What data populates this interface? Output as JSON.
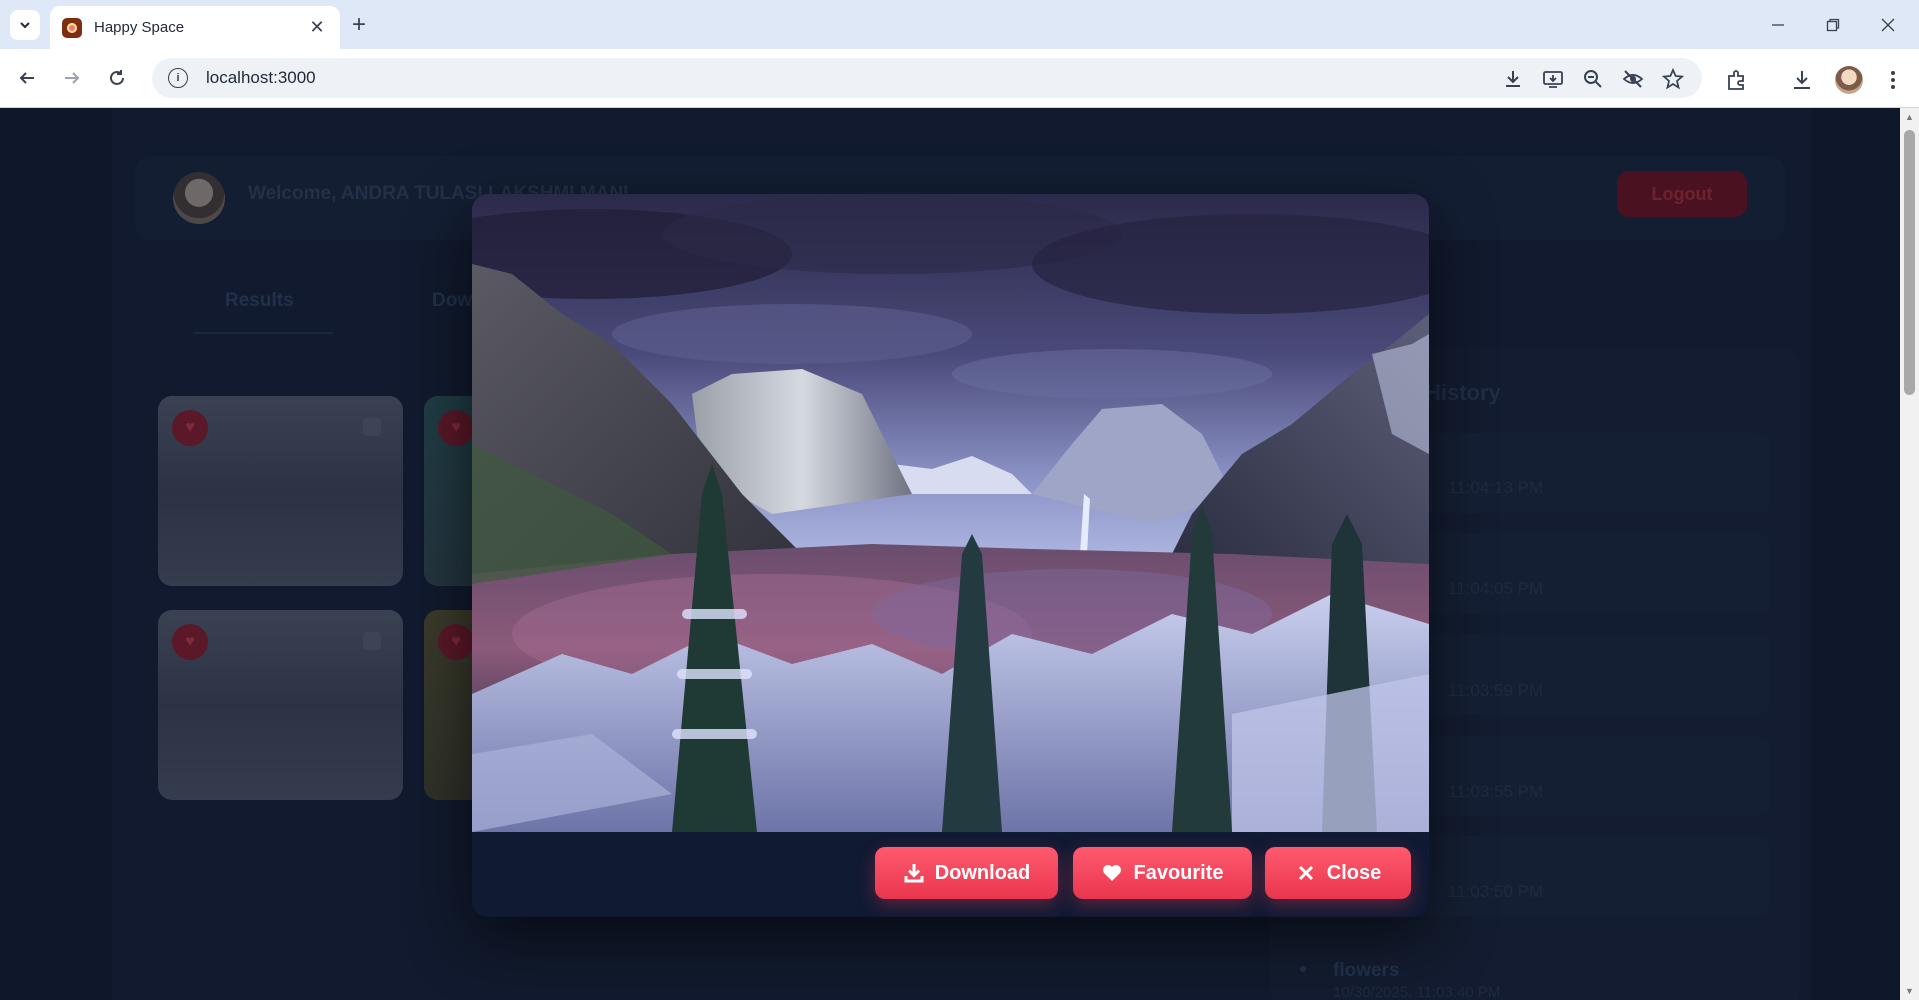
{
  "browser": {
    "tab_title": "Happy Space",
    "url": "localhost:3000"
  },
  "app": {
    "welcome_text": "Welcome, ANDRA TULASI LAKSHMI MANI",
    "logout_label": "Logout",
    "tabs": [
      {
        "label": "Results"
      },
      {
        "label": "Downloads"
      }
    ],
    "history": {
      "title": "History",
      "items": [
        {
          "time": "11:04:13 PM"
        },
        {
          "time": "11:04:05 PM"
        },
        {
          "time": "11:03:59 PM"
        },
        {
          "time": "11:03:55 PM"
        },
        {
          "time": "11:03:50 PM"
        }
      ],
      "last_query": "flowers",
      "last_date": "10/30/2025, 11:03:40 PM"
    }
  },
  "modal": {
    "image_description": "snowy mountain valley",
    "buttons": {
      "download": "Download",
      "favourite": "Favourite",
      "close": "Close"
    },
    "accent_color": "#ef4359"
  }
}
